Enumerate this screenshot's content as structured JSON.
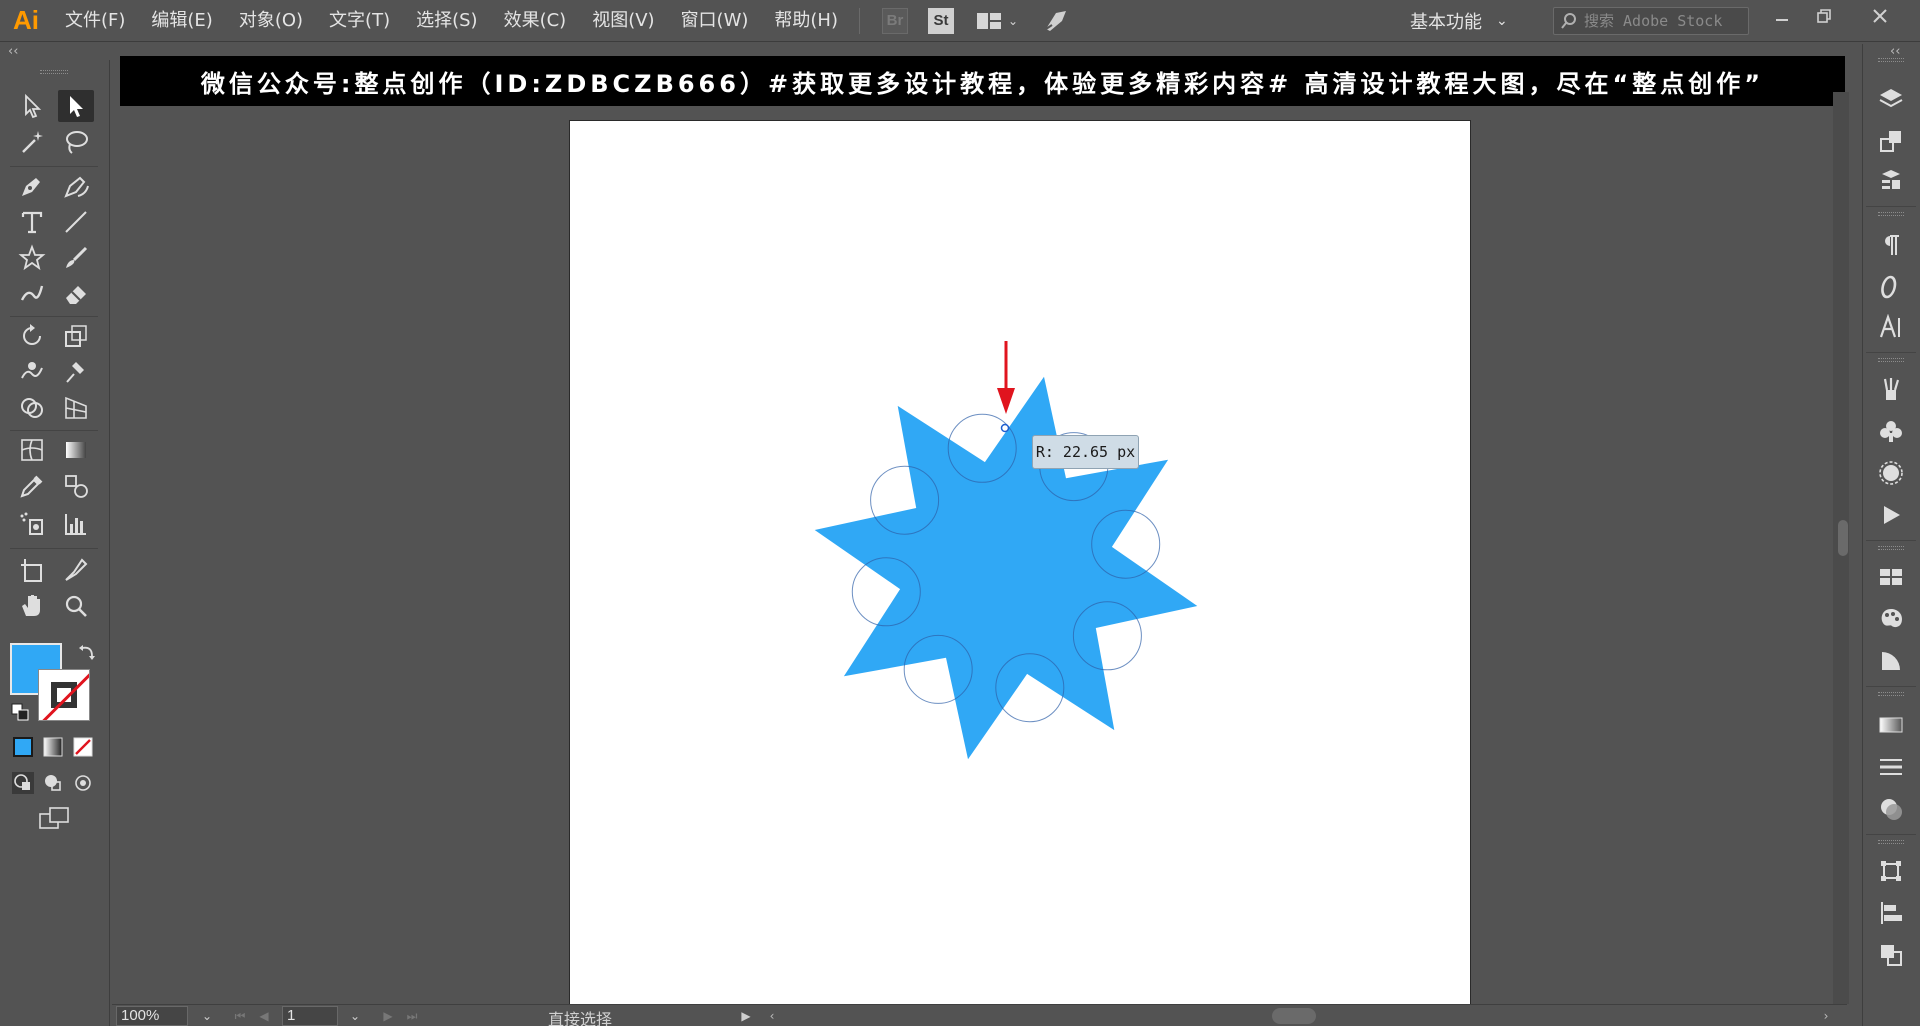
{
  "app": {
    "logo": "Ai"
  },
  "menu": {
    "items": [
      "文件(F)",
      "编辑(E)",
      "对象(O)",
      "文字(T)",
      "选择(S)",
      "效果(C)",
      "视图(V)",
      "窗口(W)",
      "帮助(H)"
    ],
    "bridge_label": "Br",
    "stock_label": "St"
  },
  "workspace": {
    "label": "基本功能"
  },
  "search": {
    "placeholder": "搜索 Adobe Stock"
  },
  "banner": {
    "text": "微信公众号:整点创作（ID:ZDBCZB666）#获取更多设计教程，体验更多精彩内容#  高清设计教程大图，尽在“整点创作”"
  },
  "canvas": {
    "shape": "eight-point-star",
    "fill_color": "#30a8f5",
    "arrow_color": "#e0141e",
    "tooltip": "R: 22.65 px"
  },
  "swatches": {
    "fill": "#30a8f5",
    "stroke": "none"
  },
  "status": {
    "zoom": "100%",
    "page": "1",
    "tool_name": "直接选择"
  },
  "icons": {
    "left_toolbar": [
      "selection-tool-icon",
      "direct-selection-tool-icon",
      "magic-wand-icon",
      "lasso-icon",
      "pen-tool-icon",
      "curvature-tool-icon",
      "type-tool-icon",
      "line-tool-icon",
      "star-tool-icon",
      "paintbrush-icon",
      "shaper-tool-icon",
      "eraser-icon",
      "rotate-tool-icon",
      "scale-tool-icon",
      "warp-tool-icon",
      "puppet-warp-icon",
      "shape-builder-icon",
      "perspective-grid-icon",
      "mesh-tool-icon",
      "gradient-tool-icon",
      "eyedropper-icon",
      "blend-tool-icon",
      "symbol-sprayer-icon",
      "graph-tool-icon",
      "artboard-tool-icon",
      "slice-tool-icon",
      "hand-tool-icon",
      "zoom-tool-icon"
    ],
    "right_panel": [
      "layers-icon",
      "artboards-icon",
      "libraries-icon",
      "paragraph-icon",
      "glyphs-icon",
      "character-icon",
      "brushes-icon",
      "symbols-icon",
      "graphic-styles-icon",
      "actions-icon",
      "swatches-icon",
      "color-icon",
      "color-guide-icon",
      "gradient-icon",
      "stroke-icon",
      "transparency-icon",
      "transform-icon",
      "align-icon",
      "pathfinder-icon"
    ]
  }
}
